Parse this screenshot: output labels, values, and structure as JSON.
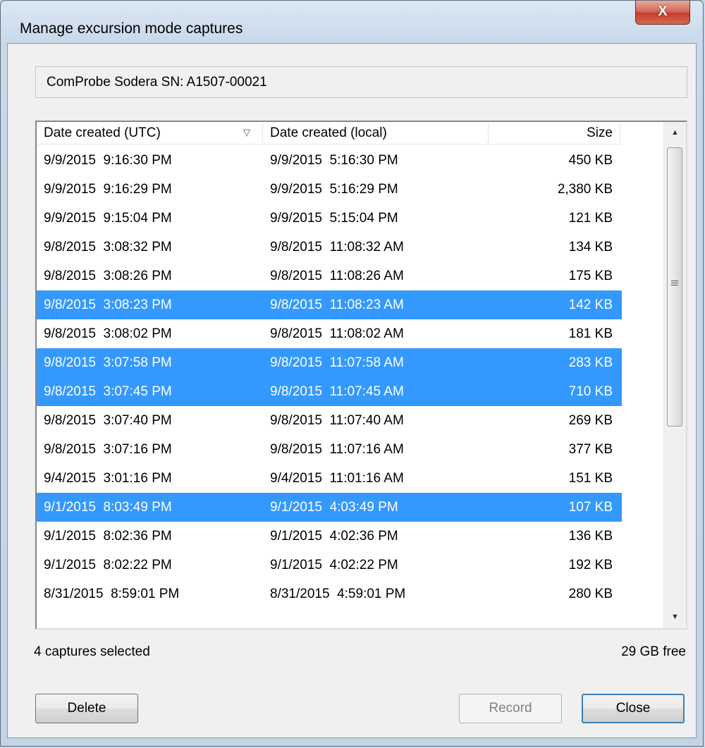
{
  "window": {
    "title": "Manage excursion mode captures",
    "close_glyph": "X"
  },
  "device": {
    "label": "ComProbe Sodera SN: A1507-00021"
  },
  "list": {
    "columns": [
      {
        "label": "Date created (UTC)",
        "sort_indicator": "descending-sort-icon"
      },
      {
        "label": "Date created (local)"
      },
      {
        "label": "Size"
      }
    ],
    "rows": [
      {
        "utc": "9/9/2015  9:16:30 PM",
        "local": "9/9/2015  5:16:30 PM",
        "size": "450 KB",
        "selected": false
      },
      {
        "utc": "9/9/2015  9:16:29 PM",
        "local": "9/9/2015  5:16:29 PM",
        "size": "2,380 KB",
        "selected": false
      },
      {
        "utc": "9/9/2015  9:15:04 PM",
        "local": "9/9/2015  5:15:04 PM",
        "size": "121 KB",
        "selected": false
      },
      {
        "utc": "9/8/2015  3:08:32 PM",
        "local": "9/8/2015  11:08:32 AM",
        "size": "134 KB",
        "selected": false
      },
      {
        "utc": "9/8/2015  3:08:26 PM",
        "local": "9/8/2015  11:08:26 AM",
        "size": "175 KB",
        "selected": false
      },
      {
        "utc": "9/8/2015  3:08:23 PM",
        "local": "9/8/2015  11:08:23 AM",
        "size": "142 KB",
        "selected": true
      },
      {
        "utc": "9/8/2015  3:08:02 PM",
        "local": "9/8/2015  11:08:02 AM",
        "size": "181 KB",
        "selected": false
      },
      {
        "utc": "9/8/2015  3:07:58 PM",
        "local": "9/8/2015  11:07:58 AM",
        "size": "283 KB",
        "selected": true
      },
      {
        "utc": "9/8/2015  3:07:45 PM",
        "local": "9/8/2015  11:07:45 AM",
        "size": "710 KB",
        "selected": true
      },
      {
        "utc": "9/8/2015  3:07:40 PM",
        "local": "9/8/2015  11:07:40 AM",
        "size": "269 KB",
        "selected": false
      },
      {
        "utc": "9/8/2015  3:07:16 PM",
        "local": "9/8/2015  11:07:16 AM",
        "size": "377 KB",
        "selected": false
      },
      {
        "utc": "9/4/2015  3:01:16 PM",
        "local": "9/4/2015  11:01:16 AM",
        "size": "151 KB",
        "selected": false
      },
      {
        "utc": "9/1/2015  8:03:49 PM",
        "local": "9/1/2015  4:03:49 PM",
        "size": "107 KB",
        "selected": true
      },
      {
        "utc": "9/1/2015  8:02:36 PM",
        "local": "9/1/2015  4:02:36 PM",
        "size": "136 KB",
        "selected": false
      },
      {
        "utc": "9/1/2015  8:02:22 PM",
        "local": "9/1/2015  4:02:22 PM",
        "size": "192 KB",
        "selected": false
      },
      {
        "utc": "8/31/2015  8:59:01 PM",
        "local": "8/31/2015  4:59:01 PM",
        "size": "280 KB",
        "selected": false
      }
    ],
    "scrollbar": {
      "up_glyph": "▲",
      "down_glyph": "▼"
    },
    "selection_color": "#3399ff"
  },
  "status": {
    "selected_text": "4 captures selected",
    "free_text": "29 GB free"
  },
  "buttons": {
    "delete": "Delete",
    "record": "Record",
    "close": "Close"
  }
}
